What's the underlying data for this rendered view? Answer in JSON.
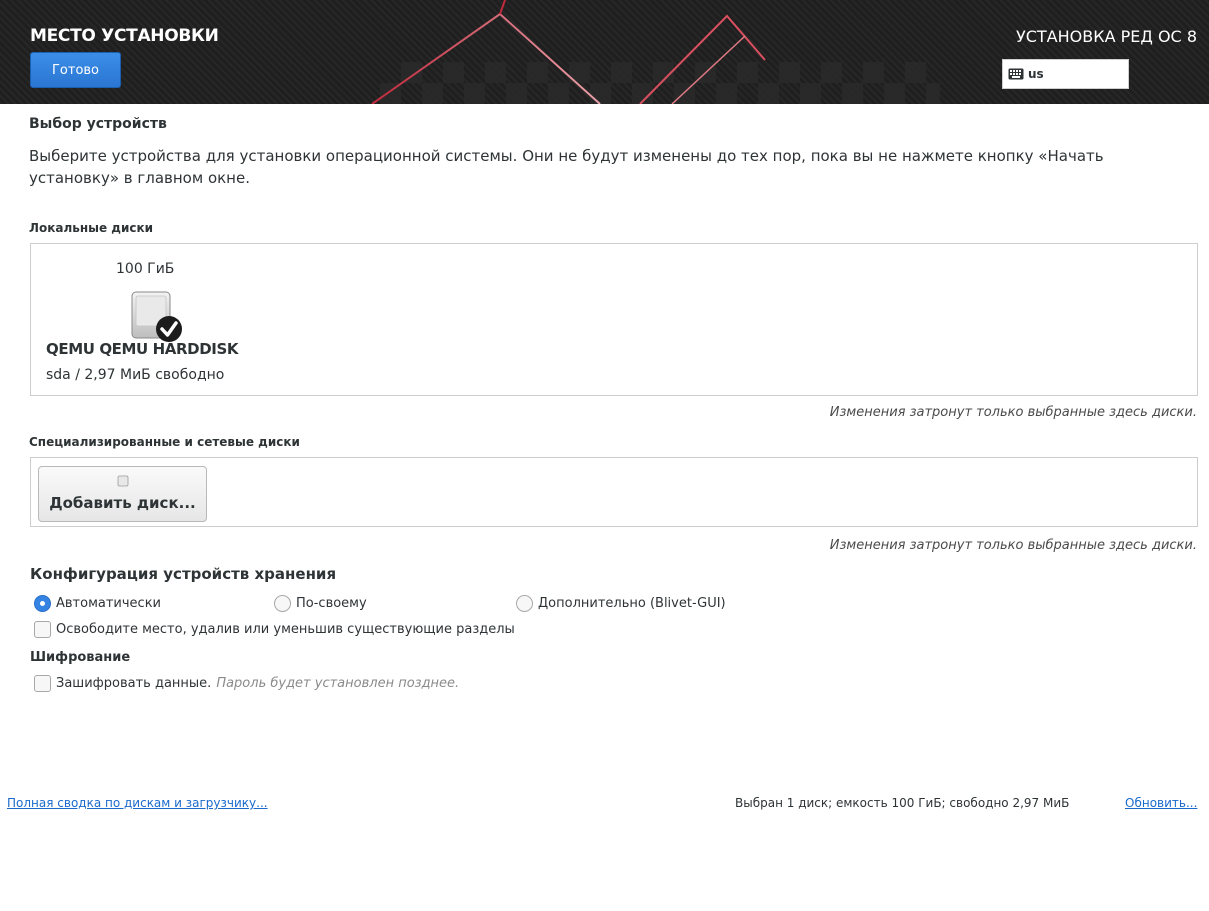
{
  "header": {
    "spoke_title": "МЕСТО УСТАНОВКИ",
    "done_label": "Готово",
    "product_title": "УСТАНОВКА РЕД ОС 8",
    "keyboard_layout": "us",
    "keyboard_icon": "keyboard-icon"
  },
  "device_selection": {
    "title": "Выбор устройств",
    "intro": "Выберите устройства для установки операционной системы. Они не будут изменены до тех пор, пока вы не нажмете кнопку «Начать установку» в главном окне."
  },
  "local_disks": {
    "heading": "Локальные диски",
    "disks": [
      {
        "size": "100 ГиБ",
        "name": "QEMU QEMU HARDDISK",
        "details": "sda  /  2,97 МиБ свободно",
        "selected": true,
        "icon": "harddisk-icon"
      }
    ],
    "hint": "Изменения затронут только выбранные здесь диски."
  },
  "network_disks": {
    "heading": "Специализированные и сетевые диски",
    "add_button": "Добавить диск...",
    "add_icon": "disk-add-icon",
    "hint": "Изменения затронут только выбранные здесь диски."
  },
  "storage_config": {
    "title": "Конфигурация устройств хранения",
    "options": [
      {
        "label": "Автоматически",
        "checked": true
      },
      {
        "label": "По-своему",
        "checked": false
      },
      {
        "label": "Дополнительно (Blivet-GUI)",
        "checked": false
      }
    ],
    "reclaim_label": "Освободите место, удалив или уменьшив существующие разделы",
    "reclaim_checked": false
  },
  "encryption": {
    "heading": "Шифрование",
    "encrypt_label": "Зашифровать данные.",
    "encrypt_note": "Пароль будет установлен позднее.",
    "encrypt_checked": false
  },
  "footer": {
    "summary_link": "Полная сводка по дискам и загрузчику...",
    "status": "Выбран 1 диск; емкость 100 ГиБ; свободно 2,97 МиБ",
    "refresh_link": "Обновить..."
  },
  "colors": {
    "accent": "#3584e4",
    "header_bg": "#1f1f1f",
    "header_accent": "#b0283a",
    "link": "#1b6acb"
  }
}
